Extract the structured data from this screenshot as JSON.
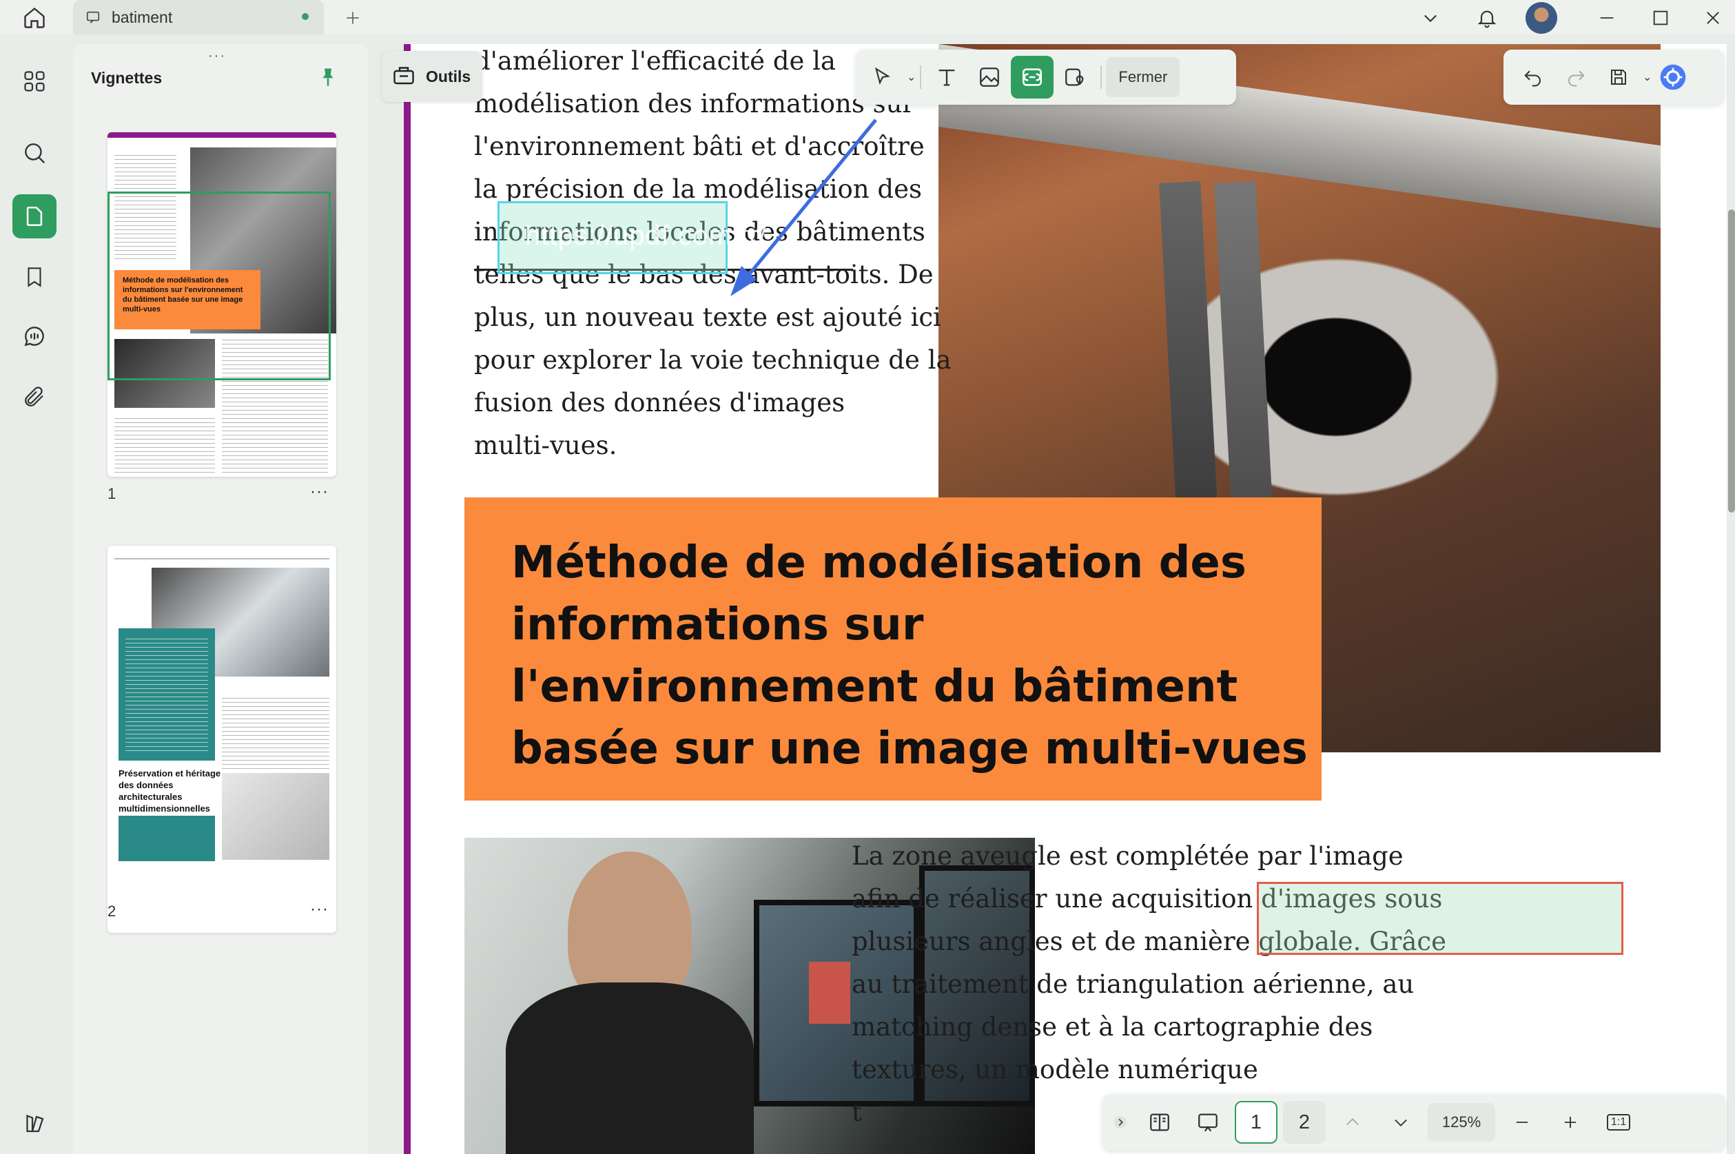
{
  "titlebar": {
    "tab_title": "batiment"
  },
  "sidebar": {
    "title": "Vignettes",
    "pages": [
      {
        "number": "1",
        "more": "···"
      },
      {
        "number": "2",
        "more": "···"
      }
    ],
    "thumb1": {
      "heading": "Méthode de modélisation des informations sur l'environnement du bâtiment basée sur une image multi-vues"
    },
    "thumb2": {
      "heading": "Préservation et héritage des données architecturales multidimensionnelles"
    }
  },
  "toolbar": {
    "outils_label": "Outils",
    "fermer_label": "Fermer"
  },
  "document": {
    "left_column_lines": [
      "d'améliorer l'efficacité de la",
      "modélisation des informations sur",
      "l'environnement bâti et d'accroître",
      "la précision de la modélisation des",
      "informations locales des bâtiments",
      "telles que le bas des avant-toits. De",
      "plus, un nouveau texte est ajouté ici",
      "pour explorer la voie technique de la",
      "fusion des données d'images",
      "multi-vues."
    ],
    "heading_lines": [
      "Méthode de modélisation des",
      "informations sur",
      "l'environnement du bâtiment",
      "basée sur une image multi-vues"
    ],
    "right_column_lines": [
      "La zone aveugle est complétée par l'image",
      "afin de réaliser une acquisition d'images sous",
      "plusieurs angles et de manière globale. Grâce",
      "au traitement de triangulation aérienne, au",
      "matching dense et à la cartographie des",
      "textures, un modèle numérique",
      "t"
    ],
    "link_annotation": "https://updf.com/fr/"
  },
  "bottom_bar": {
    "pages": [
      "1",
      "2"
    ],
    "current_page": "1",
    "zoom": "125%",
    "fit_label": "1:1"
  },
  "colors": {
    "accent": "#2e9d5e",
    "heading_bg": "#fb8a3c",
    "page_border": "#8c1a8c"
  }
}
